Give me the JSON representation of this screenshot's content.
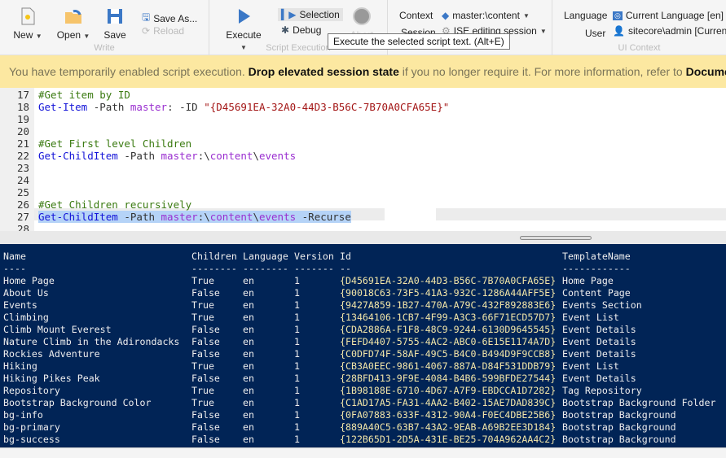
{
  "toolbar": {
    "write": {
      "label": "Write",
      "new": "New",
      "open": "Open",
      "save": "Save",
      "save_as": "Save As...",
      "reload": "Reload"
    },
    "exec": {
      "label": "Script Execution",
      "execute": "Execute",
      "selection": "Selection",
      "debug": "Debug",
      "abort": "Abort"
    },
    "context": {
      "context_label": "Context",
      "context_value": "master:\\content",
      "session_label": "Session",
      "session_value": "ISE editing session"
    },
    "ui": {
      "label": "UI Context",
      "language_label": "Language",
      "language_value": "Current Language [en]",
      "user_label": "User",
      "user_value": "sitecore\\admin [Current]"
    },
    "tooltip": "Execute the selected script text. (Alt+E)"
  },
  "warning": {
    "prefix": "You have temporarily enabled script execution. ",
    "link": "Drop elevated session state",
    "middle": " if you no longer require it. For more information, refer to ",
    "doc": "Documentation"
  },
  "editor": {
    "lines": [
      {
        "n": "17",
        "parts": [
          [
            "cm",
            "#Get item by ID"
          ]
        ]
      },
      {
        "n": "18",
        "parts": [
          [
            "kw",
            "Get-Item"
          ],
          [
            "pa",
            " -Path "
          ],
          [
            "mv",
            "master"
          ],
          [
            "pa",
            ": -ID "
          ],
          [
            "st",
            "\"{D45691EA-32A0-44D3-B56C-7B70A0CFA65E}\""
          ]
        ]
      },
      {
        "n": "19",
        "parts": []
      },
      {
        "n": "20",
        "parts": []
      },
      {
        "n": "21",
        "parts": [
          [
            "cm",
            "#Get First level Children"
          ]
        ]
      },
      {
        "n": "22",
        "parts": [
          [
            "kw",
            "Get-ChildItem"
          ],
          [
            "pa",
            " -Path "
          ],
          [
            "mv",
            "master"
          ],
          [
            "pa",
            ":\\"
          ],
          [
            "mv",
            "content"
          ],
          [
            "pa",
            "\\"
          ],
          [
            "mv",
            "events"
          ]
        ]
      },
      {
        "n": "23",
        "parts": []
      },
      {
        "n": "24",
        "parts": []
      },
      {
        "n": "25",
        "parts": []
      },
      {
        "n": "26",
        "parts": [
          [
            "cm",
            "#Get Children recursively"
          ]
        ]
      },
      {
        "n": "27",
        "parts": [
          [
            "kw",
            "Get-ChildItem"
          ],
          [
            "pa",
            " -Path "
          ],
          [
            "mv",
            "master"
          ],
          [
            "pa",
            ":\\"
          ],
          [
            "mv",
            "content"
          ],
          [
            "pa",
            "\\"
          ],
          [
            "mv",
            "events"
          ],
          [
            "pa",
            " -Recurse"
          ]
        ]
      },
      {
        "n": "28",
        "parts": []
      }
    ]
  },
  "console": {
    "headers": [
      "Name",
      "Children",
      "Language",
      "Version",
      "Id",
      "TemplateName"
    ],
    "dashes": [
      "----",
      "--------",
      "--------",
      "-------",
      "--",
      "------------"
    ],
    "rows": [
      [
        "Home Page",
        "True",
        "en",
        "1",
        "{D45691EA-32A0-44D3-B56C-7B70A0CFA65E}",
        "Home Page"
      ],
      [
        "About Us",
        "False",
        "en",
        "1",
        "{90018C63-73F5-41A3-932C-1286A44AFF5E}",
        "Content Page"
      ],
      [
        "Events",
        "True",
        "en",
        "1",
        "{9427A859-1B27-470A-A79C-432F892883E6}",
        "Events Section"
      ],
      [
        "Climbing",
        "True",
        "en",
        "1",
        "{13464106-1CB7-4F99-A3C3-66F71ECD57D7}",
        "Event List"
      ],
      [
        "Climb Mount Everest",
        "False",
        "en",
        "1",
        "{CDA2886A-F1F8-48C9-9244-6130D9645545}",
        "Event Details"
      ],
      [
        "Nature Climb in the Adirondacks",
        "False",
        "en",
        "1",
        "{FEFD4407-5755-4AC2-ABC0-6E15E1174A7D}",
        "Event Details"
      ],
      [
        "Rockies Adventure",
        "False",
        "en",
        "1",
        "{C0DFD74F-58AF-49C5-B4C0-B494D9F9CCB8}",
        "Event Details"
      ],
      [
        "Hiking",
        "True",
        "en",
        "1",
        "{CB3A0EEC-9861-4067-887A-D84F531DDB79}",
        "Event List"
      ],
      [
        "Hiking Pikes Peak",
        "False",
        "en",
        "1",
        "{28BFD413-9F9E-4084-B4B6-599BFDE27544}",
        "Event Details"
      ],
      [
        "Repository",
        "True",
        "en",
        "1",
        "{1B98188E-6710-4D67-A7F9-EBDCCA1D7282}",
        "Tag Repository"
      ],
      [
        "Bootstrap Background Color",
        "True",
        "en",
        "1",
        "{C1AD17A5-FA31-4AA2-B402-15AE7DAD839C}",
        "Bootstrap Background Folder"
      ],
      [
        "bg-info",
        "False",
        "en",
        "1",
        "{0FA07883-633F-4312-90A4-F0EC4DBE25B6}",
        "Bootstrap Background"
      ],
      [
        "bg-primary",
        "False",
        "en",
        "1",
        "{889A40C5-63B7-43A2-9EAB-A69B2EE3D184}",
        "Bootstrap Background"
      ],
      [
        "bg-success",
        "False",
        "en",
        "1",
        "{122B65D1-2D5A-431E-BE25-704A962AA4C2}",
        "Bootstrap Background"
      ]
    ]
  },
  "colors": {
    "console_bg": "#012456",
    "warning_bg": "#fce8a1",
    "accent": "#3b78c6"
  }
}
